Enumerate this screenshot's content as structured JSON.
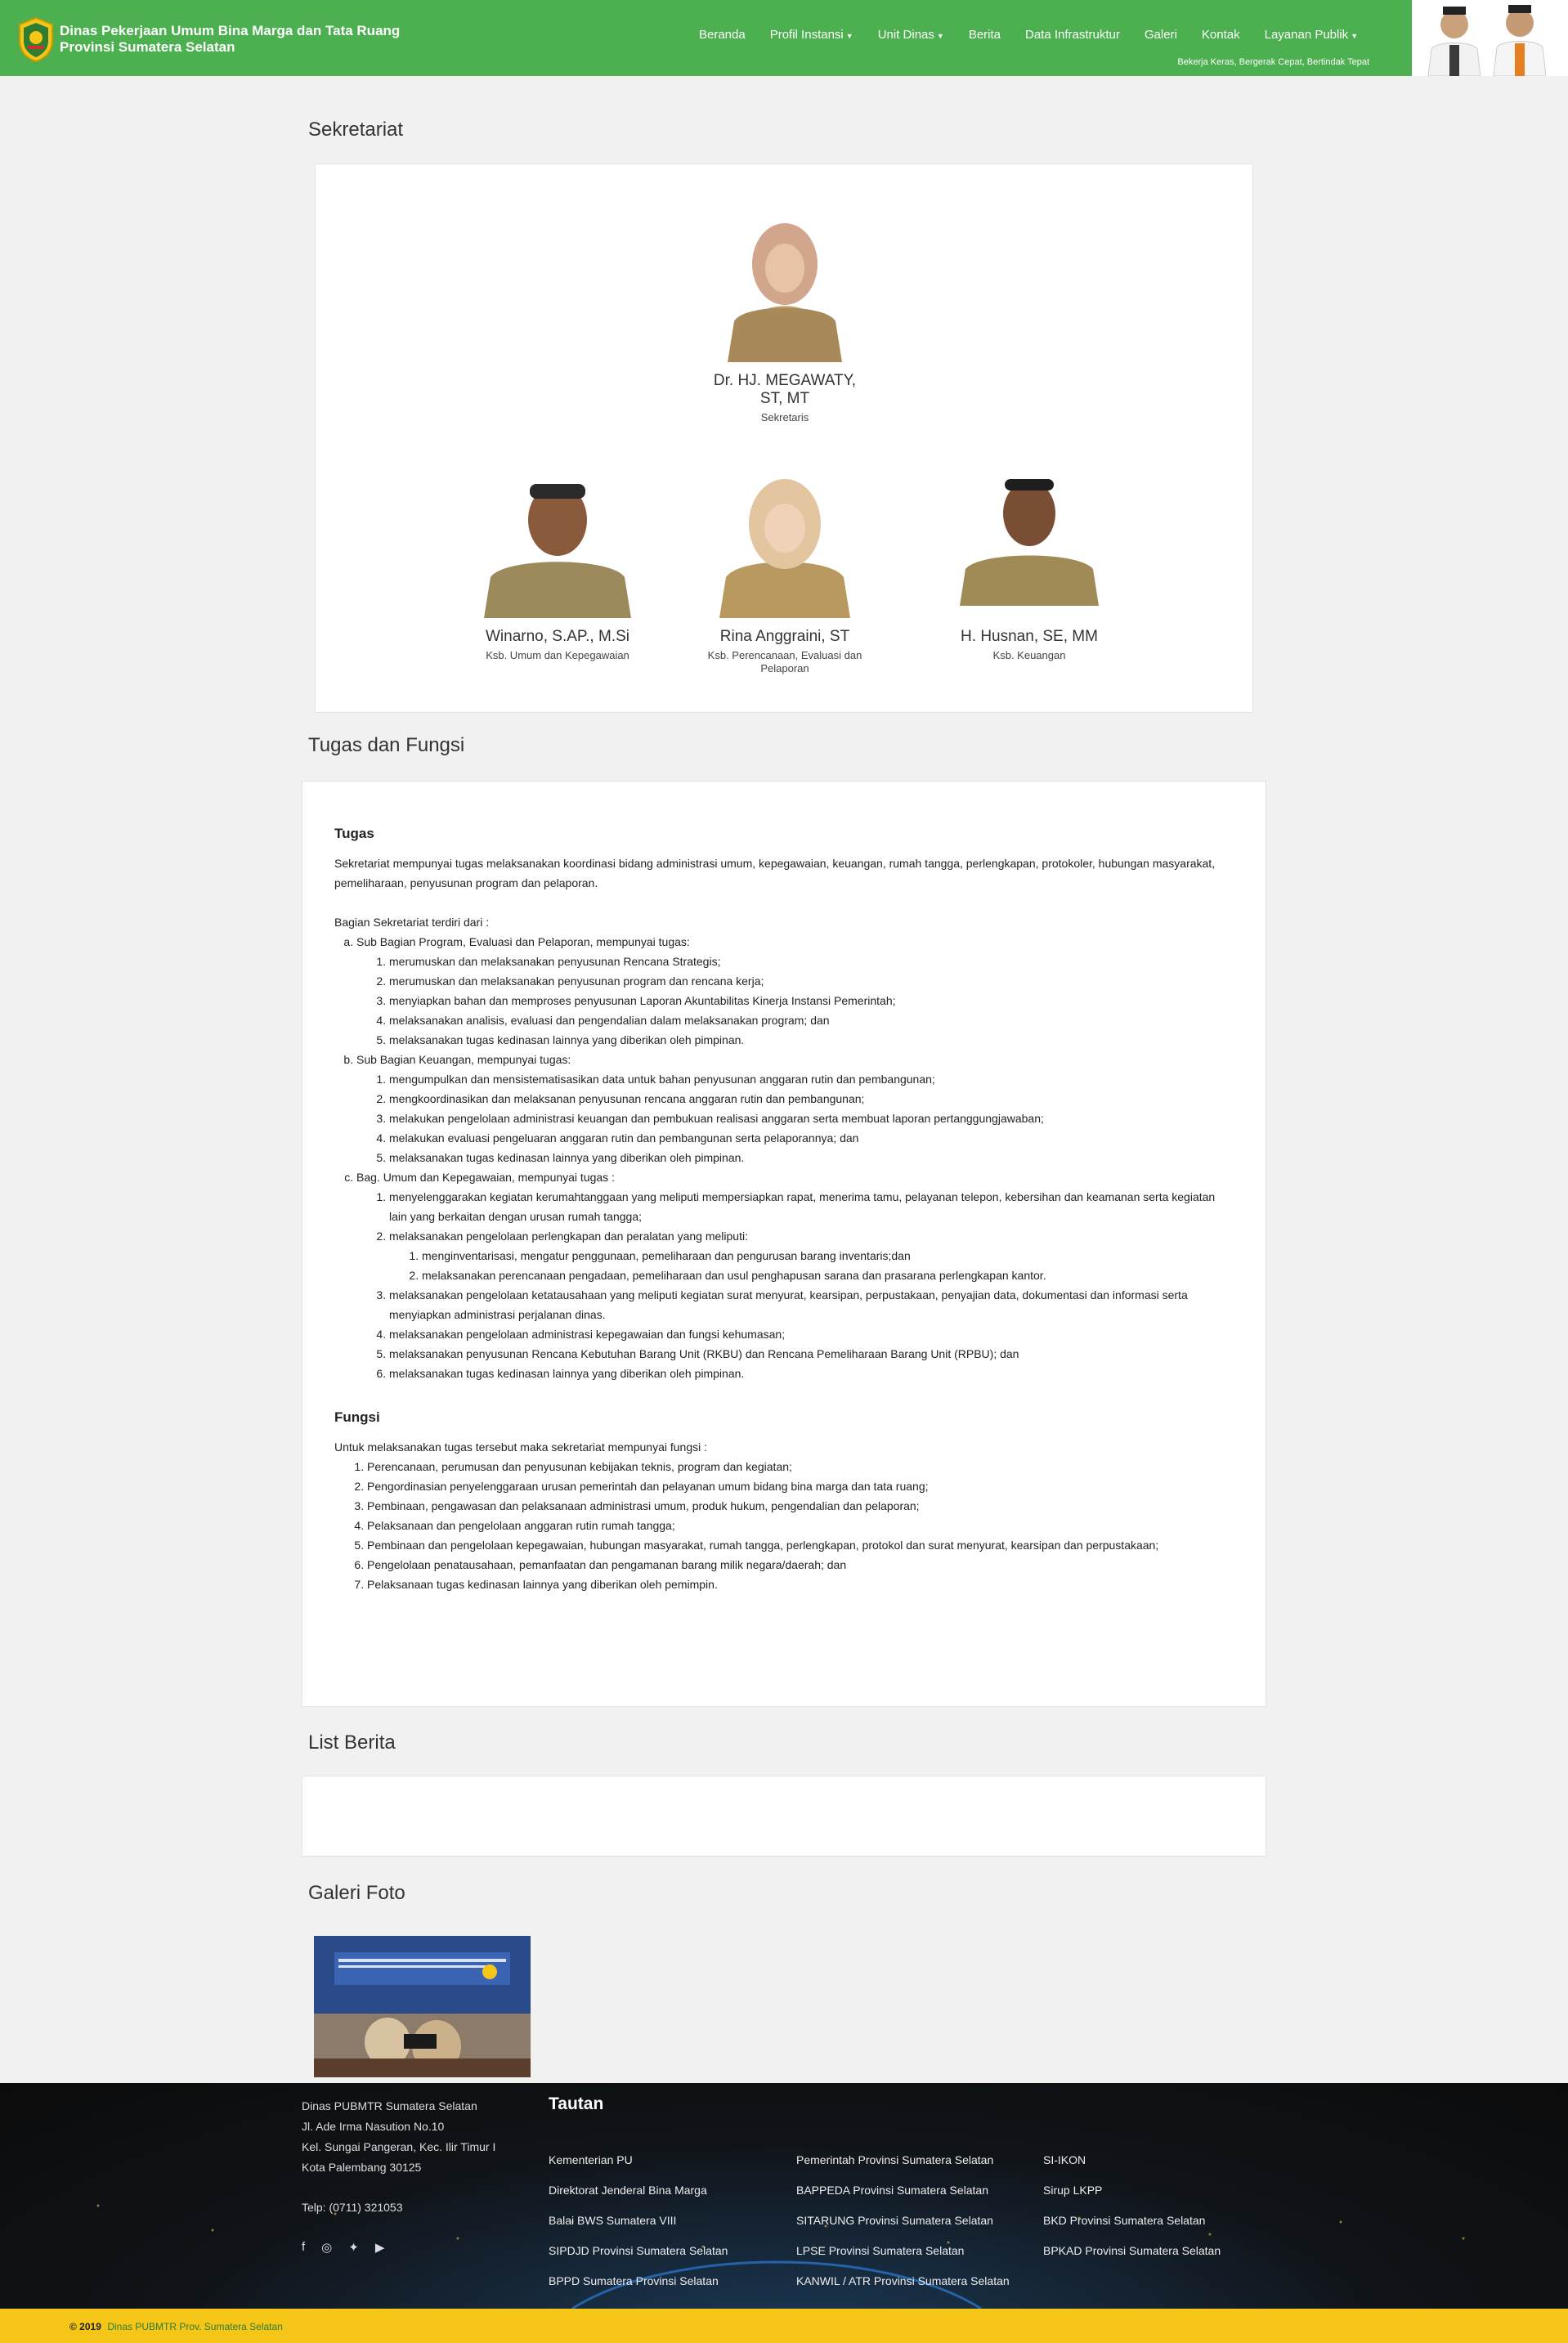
{
  "header": {
    "brand_line1": "Dinas Pekerjaan Umum Bina Marga dan Tata Ruang",
    "brand_line2": "Provinsi Sumatera Selatan",
    "tagline": "Bekerja Keras, Bergerak Cepat, Bertindak Tepat",
    "nav": [
      {
        "label": "Beranda"
      },
      {
        "label": "Profil Instansi",
        "dropdown": true
      },
      {
        "label": "Unit Dinas",
        "dropdown": true
      },
      {
        "label": "Berita"
      },
      {
        "label": "Data Infrastruktur"
      },
      {
        "label": "Galeri"
      },
      {
        "label": "Kontak"
      },
      {
        "label": "Layanan Publik",
        "dropdown": true
      }
    ]
  },
  "sekretariat": {
    "title": "Sekretariat",
    "head": {
      "name_line1": "Dr. HJ. MEGAWATY,",
      "name_line2": "ST, MT",
      "role": "Sekretaris"
    },
    "staff": [
      {
        "name": "Winarno, S.AP., M.Si",
        "role": "Ksb. Umum dan Kepegawaian"
      },
      {
        "name": "Rina Anggraini, ST",
        "role_line1": "Ksb. Perencanaan, Evaluasi dan",
        "role_line2": "Pelaporan"
      },
      {
        "name": "H. Husnan, SE, MM",
        "role": "Ksb. Keuangan"
      }
    ]
  },
  "tugas_fungsi": {
    "title": "Tugas dan Fungsi",
    "tugas_heading": "Tugas",
    "tugas_text": "Sekretariat mempunyai tugas melaksanakan koordinasi bidang administrasi umum, kepegawaian, keuangan, rumah tangga, perlengkapan, protokoler, hubungan masyarakat, pemeliharaan, penyusunan program dan pelaporan.",
    "bagian_intro": "Bagian Sekretariat terdiri dari :",
    "sub_a": {
      "label": "Sub Bagian Program, Evaluasi dan Pelaporan, mempunyai tugas:",
      "items": [
        "merumuskan dan melaksanakan penyusunan Rencana Strategis;",
        "merumuskan dan melaksanakan penyusunan program dan rencana kerja;",
        "menyiapkan bahan dan memproses penyusunan Laporan Akuntabilitas Kinerja Instansi Pemerintah;",
        "melaksanakan analisis, evaluasi dan pengendalian dalam melaksanakan program; dan",
        "melaksanakan tugas kedinasan lainnya yang diberikan oleh pimpinan."
      ]
    },
    "sub_b": {
      "label": "Sub Bagian Keuangan, mempunyai tugas:",
      "items": [
        "mengumpulkan dan mensistematisasikan data untuk bahan penyusunan anggaran rutin dan pembangunan;",
        "mengkoordinasikan dan melaksanan penyusunan rencana anggaran rutin dan pembangunan;",
        "melakukan pengelolaan administrasi keuangan dan pembukuan realisasi anggaran serta membuat laporan pertanggungjawaban;",
        "melakukan evaluasi pengeluaran anggaran rutin dan pembangunan serta pelaporannya; dan",
        "melaksanakan tugas kedinasan lainnya yang diberikan oleh pimpinan."
      ]
    },
    "sub_c": {
      "label": "Bag. Umum dan Kepegawaian, mempunyai tugas :",
      "item1": "menyelenggarakan kegiatan kerumahtanggaan yang meliputi mempersiapkan rapat, menerima tamu, pelayanan telepon, kebersihan dan keamanan serta kegiatan lain yang berkaitan dengan urusan rumah tangga;",
      "item2": "melaksanakan pengelolaan perlengkapan dan peralatan yang meliputi:",
      "item2_sub": [
        "menginventarisasi, mengatur penggunaan, pemeliharaan dan pengurusan barang inventaris;dan",
        "melaksanakan perencanaan pengadaan, pemeliharaan dan usul penghapusan sarana dan prasarana perlengkapan kantor."
      ],
      "items_rest": [
        "melaksanakan pengelolaan ketatausahaan yang meliputi kegiatan surat menyurat, kearsipan, perpustakaan, penyajian data, dokumentasi dan informasi serta menyiapkan administrasi perjalanan dinas.",
        "melaksanakan pengelolaan administrasi kepegawaian dan fungsi kehumasan;",
        "melaksanakan penyusunan Rencana Kebutuhan Barang Unit (RKBU) dan Rencana Pemeliharaan Barang Unit (RPBU); dan",
        "melaksanakan tugas kedinasan lainnya yang diberikan oleh pimpinan."
      ]
    },
    "fungsi_heading": "Fungsi",
    "fungsi_intro": "Untuk melaksanakan tugas tersebut maka sekretariat mempunyai fungsi :",
    "fungsi_items": [
      "Perencanaan, perumusan dan penyusunan kebijakan teknis, program dan kegiatan;",
      "Pengordinasian penyelenggaraan urusan pemerintah dan pelayanan umum bidang bina marga dan tata ruang;",
      "Pembinaan, pengawasan dan pelaksanaan administrasi umum, produk hukum, pengendalian dan pelaporan;",
      "Pelaksanaan dan pengelolaan anggaran rutin rumah tangga;",
      "Pembinaan dan pengelolaan kepegawaian, hubungan masyarakat, rumah tangga, perlengkapan, protokol dan surat menyurat, kearsipan dan perpustakaan;",
      "Pengelolaan penatausahaan, pemanfaatan dan pengamanan barang milik negara/daerah; dan",
      "Pelaksanaan tugas kedinasan lainnya yang diberikan oleh pemimpin."
    ]
  },
  "list_berita": {
    "title": "List Berita"
  },
  "galeri": {
    "title": "Galeri Foto"
  },
  "footer": {
    "address": [
      "Dinas PUBMTR Sumatera Selatan",
      "Jl. Ade Irma Nasution No.10",
      "Kel. Sungai Pangeran, Kec. Ilir Timur I",
      "Kota Palembang 30125"
    ],
    "phone": "Telp: (0711) 321053",
    "social_icons": [
      "facebook-icon",
      "instagram-icon",
      "twitter-icon",
      "youtube-icon"
    ],
    "tautan_title": "Tautan",
    "links_col1": [
      "Kementerian PU",
      "Direktorat Jenderal Bina Marga",
      "Balai BWS Sumatera VIII",
      "SIPDJD Provinsi Sumatera Selatan",
      "BPPD Sumatera Provinsi Selatan"
    ],
    "links_col2": [
      "Pemerintah Provinsi Sumatera Selatan",
      "BAPPEDA Provinsi Sumatera Selatan",
      "SITARUNG Provinsi Sumatera Selatan",
      "LPSE Provinsi Sumatera Selatan",
      "KANWIL / ATR Provinsi Sumatera Selatan"
    ],
    "links_col3": [
      "SI-IKON",
      "Sirup LKPP",
      "BKD Provinsi Sumatera Selatan",
      "BPKAD Provinsi Sumatera Selatan"
    ],
    "copyright_prefix": "© 2019",
    "copyright_link": "Dinas PUBMTR Prov. Sumatera Selatan"
  },
  "colors": {
    "header_green": "#4caf50",
    "footer_bar": "#f5c518",
    "copyright_link": "#2e7d32"
  }
}
